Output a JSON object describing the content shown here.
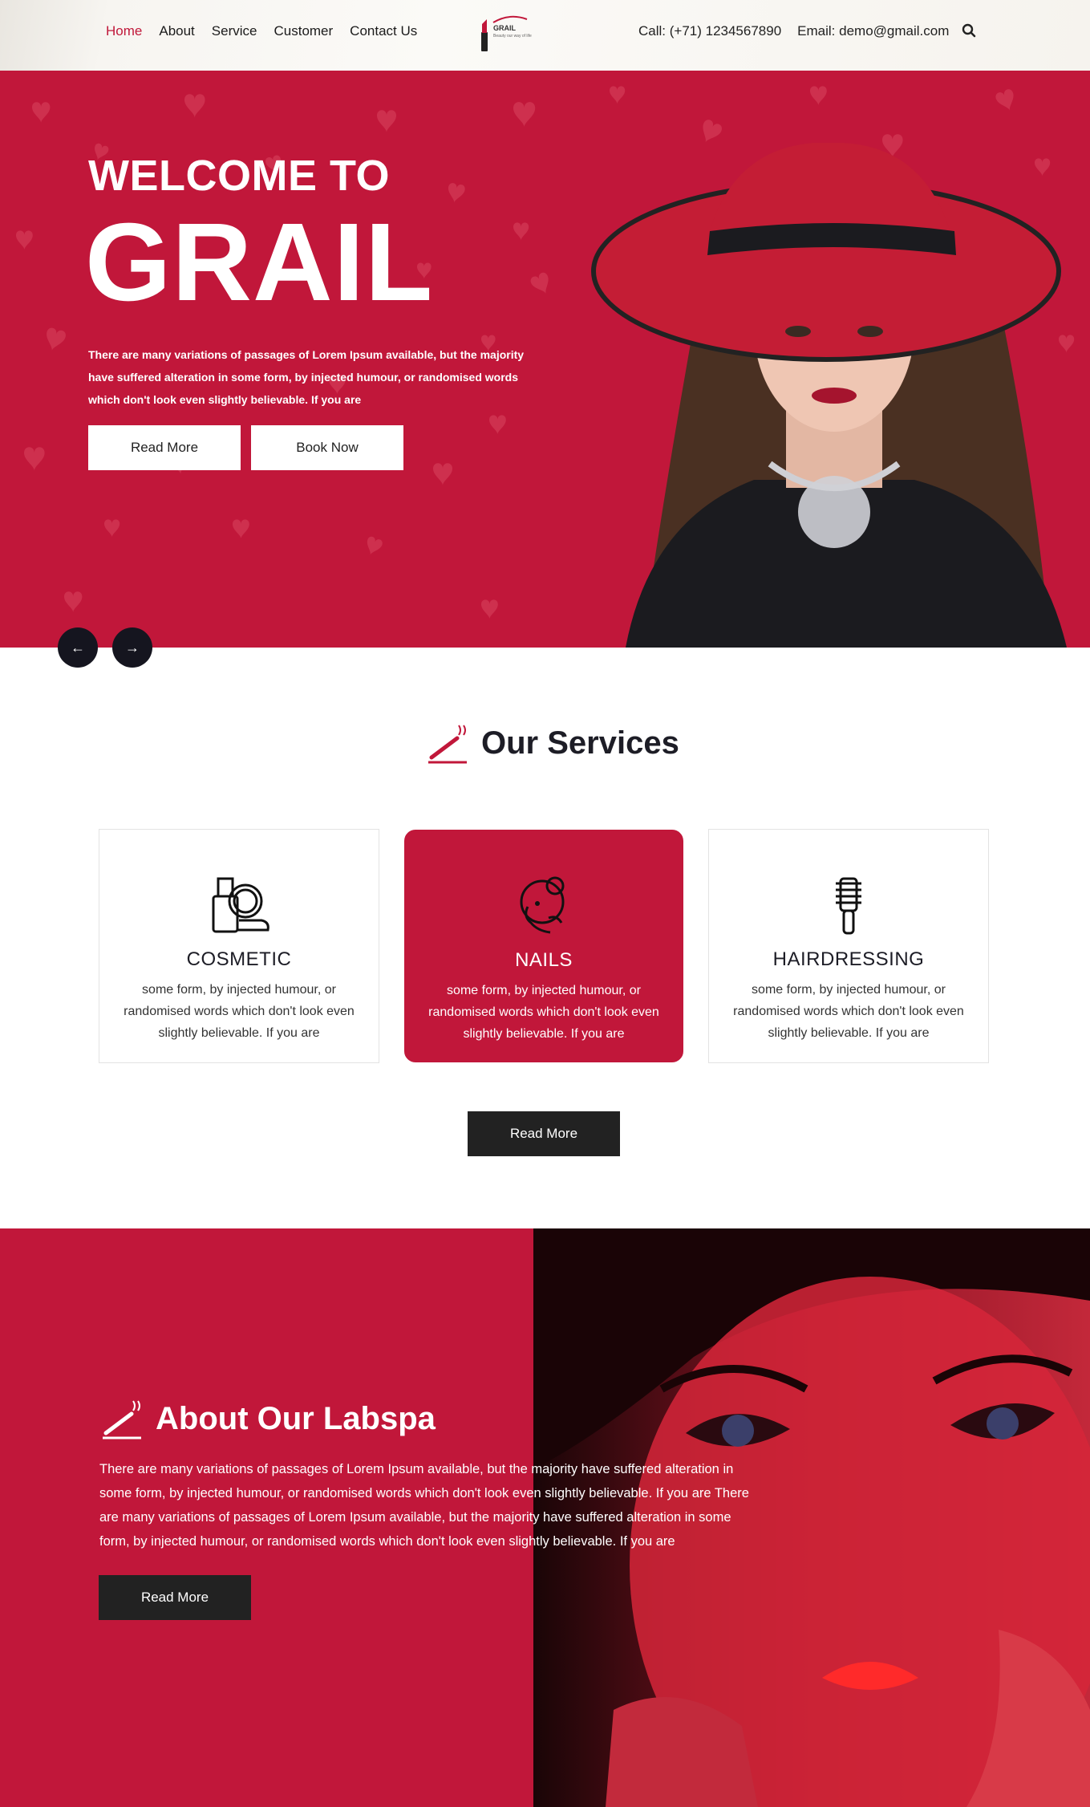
{
  "header": {
    "nav": [
      "Home",
      "About",
      "Service",
      "Customer",
      "Contact Us"
    ],
    "logo_name": "GRAIL",
    "logo_tagline": "Beauty our way of life",
    "phone": "Call: (+71) 1234567890",
    "email": "Email: demo@gmail.com"
  },
  "hero": {
    "welcome": "WELCOME TO",
    "brand": "GRAIL",
    "text": "There are many variations of passages of Lorem Ipsum available, but the majority have suffered alteration in some form, by injected humour, or randomised words which don't look even slightly believable. If you are",
    "read_more": "Read More",
    "book_now": "Book Now",
    "prev": "←",
    "next": "→"
  },
  "services": {
    "title": "Our Services",
    "cards": [
      {
        "name": "COSMETIC",
        "desc": "some form, by injected humour, or randomised words which don't look even slightly believable. If you are"
      },
      {
        "name": "NAILS",
        "desc": "some form, by injected humour, or randomised words which don't look even slightly believable. If you are"
      },
      {
        "name": "HAIRDRESSING",
        "desc": "some form, by injected humour, or randomised words which don't look even slightly believable. If you are"
      }
    ],
    "read_more": "Read More"
  },
  "about": {
    "title": "About Our Labspa",
    "text": "There are many variations of passages of Lorem Ipsum available, but the majority have suffered alteration in some form, by injected humour, or randomised words which don't look even slightly believable. If you are There are many variations of passages of Lorem Ipsum available, but the majority have suffered alteration in some form, by injected humour, or randomised words which don't look even slightly believable. If you are",
    "read_more": "Read More"
  },
  "colors": {
    "accent": "#c1173a",
    "dark": "#222222",
    "navy": "#15151f"
  }
}
